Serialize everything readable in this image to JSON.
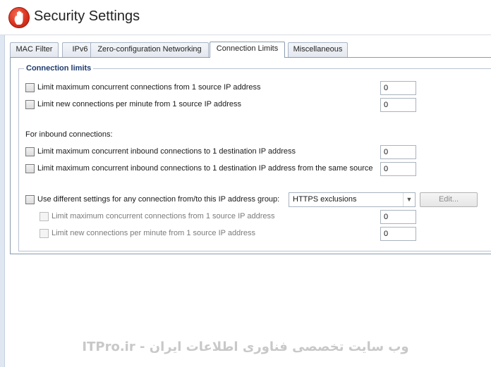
{
  "window": {
    "title": "Security Settings",
    "icon": "hand-stop-icon"
  },
  "tabs": [
    {
      "label": "MAC Filter",
      "active": false
    },
    {
      "label": "IPv6",
      "active": false
    },
    {
      "label": "Zero-configuration Networking",
      "active": false
    },
    {
      "label": "Connection Limits",
      "active": true
    },
    {
      "label": "Miscellaneous",
      "active": false
    }
  ],
  "connection_limits": {
    "group_title": "Connection limits",
    "rows": [
      {
        "label": "Limit maximum concurrent connections from 1 source IP address",
        "value": "0",
        "checked": false
      },
      {
        "label": "Limit new connections per minute from 1 source IP address",
        "value": "0",
        "checked": false
      }
    ],
    "inbound_heading": "For inbound connections:",
    "inbound_rows": [
      {
        "label": "Limit maximum concurrent inbound connections to 1 destination IP address",
        "value": "0",
        "checked": false
      },
      {
        "label": "Limit maximum concurrent inbound connections to 1 destination IP address from the same source",
        "value": "0",
        "checked": false
      }
    ],
    "group_settings": {
      "label": "Use different settings for any connection from/to this IP address group:",
      "checked": false,
      "selected_group": "HTTPS exclusions",
      "edit_button": "Edit...",
      "sub_rows": [
        {
          "label": "Limit maximum concurrent connections from 1 source IP address",
          "value": "0",
          "enabled": false
        },
        {
          "label": "Limit new connections per minute from 1 source IP address",
          "value": "0",
          "enabled": false
        }
      ]
    }
  },
  "watermark": "ITPro.ir - وب سایت تخصصی فناوری اطلاعات ایران",
  "colors": {
    "accent": "#1f3b6e",
    "icon_red": "#d8301c",
    "border": "#8a9ab0"
  }
}
